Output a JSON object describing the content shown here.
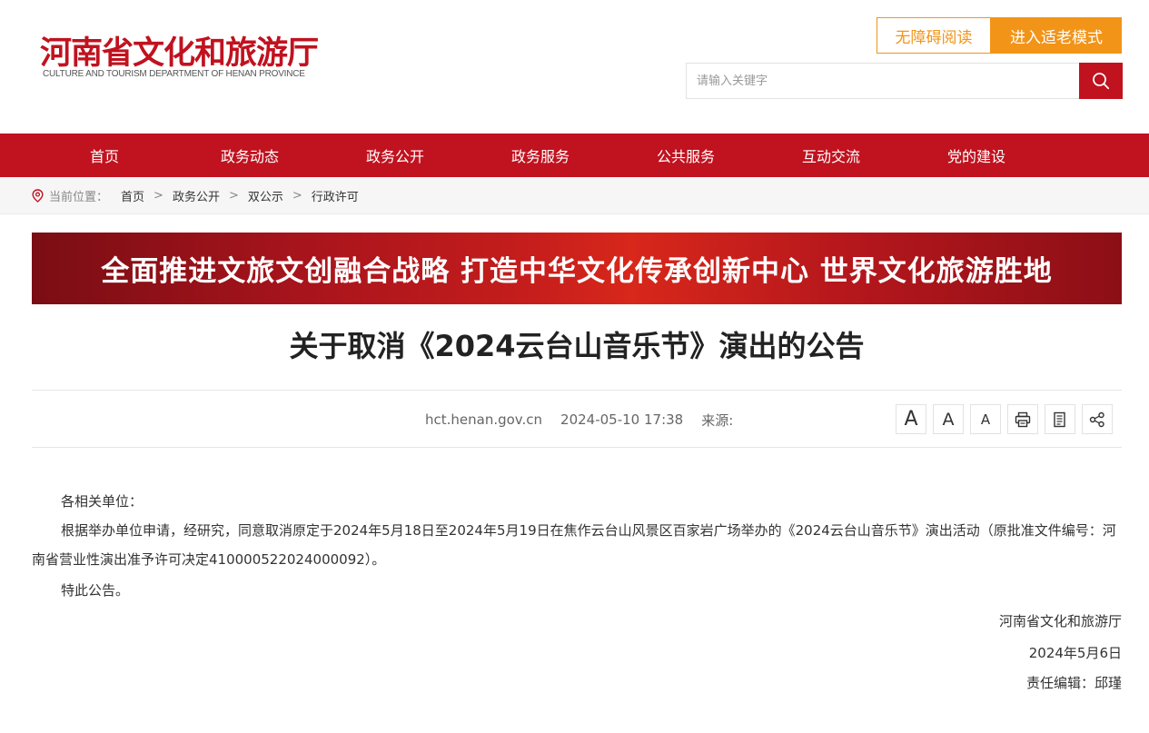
{
  "header": {
    "logo_cn": "河南省文化和旅游厅",
    "logo_en": "CULTURE AND TOURISM DEPARTMENT OF HENAN PROVINCE",
    "accessible_label": "无障碍阅读",
    "elder_mode_label": "进入适老模式",
    "search_placeholder": "请输入关键字",
    "accent_color": "#c1121f",
    "orange_color": "#f29418"
  },
  "nav": {
    "items": [
      "首页",
      "政务动态",
      "政务公开",
      "政务服务",
      "公共服务",
      "互动交流",
      "党的建设"
    ]
  },
  "breadcrumb": {
    "label": "当前位置：",
    "items": [
      "首页",
      "政务公开",
      "双公示",
      "行政许可"
    ]
  },
  "banner": {
    "text": "全面推进文旅文创融合战略  打造中华文化传承创新中心   世界文化旅游胜地"
  },
  "article": {
    "title": "关于取消《2024云台山音乐节》演出的公告",
    "source_site": "hct.henan.gov.cn",
    "datetime": "2024-05-10 17:38",
    "source_label": "来源:",
    "tools": [
      "font-large-icon",
      "font-medium-icon",
      "font-small-icon",
      "print-icon",
      "document-icon",
      "share-icon"
    ],
    "font_large": "A",
    "font_medium": "A",
    "font_small": "A",
    "salutation": "各相关单位：",
    "body": "根据举办单位申请，经研究，同意取消原定于2024年5月18日至2024年5月19日在焦作云台山风景区百家岩广场举办的《2024云台山音乐节》演出活动（原批准文件编号：河南省营业性演出准予许可决定410000522024000092）。",
    "closing": "特此公告。",
    "issuer": "河南省文化和旅游厅",
    "issue_date": "2024年5月6日",
    "editor": "责任编辑：邱瑾"
  }
}
